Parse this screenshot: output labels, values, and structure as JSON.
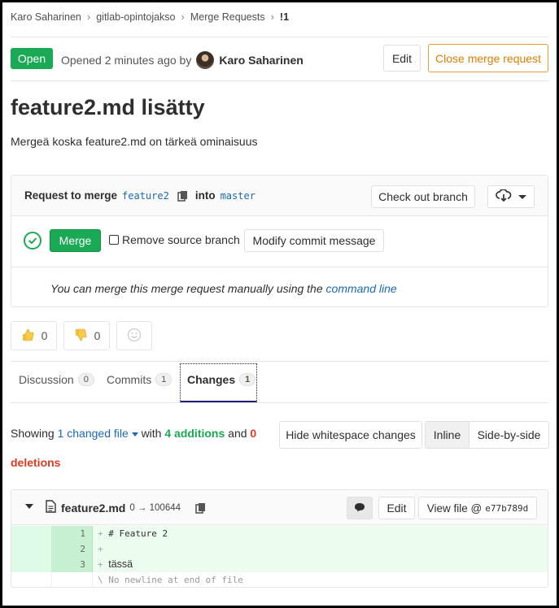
{
  "breadcrumb": [
    "Karo Saharinen",
    "gitlab-opintojakso",
    "Merge Requests",
    "!1"
  ],
  "header": {
    "status": "Open",
    "opened_text": "Opened 2 minutes ago by",
    "author": "Karo Saharinen",
    "edit_label": "Edit",
    "close_label": "Close merge request"
  },
  "mr": {
    "title": "feature2.md lisätty",
    "description": "Mergeä koska feature2.md on tärkeä ominaisuus"
  },
  "widget": {
    "request_prefix": "Request to merge",
    "source_branch": "feature2",
    "into_label": "into",
    "target_branch": "master",
    "checkout_label": "Check out branch",
    "merge_label": "Merge",
    "remove_source_label": "Remove source branch",
    "modify_commit_label": "Modify commit message",
    "manual_text": "You can merge this merge request manually using the",
    "manual_link": "command line"
  },
  "awards": {
    "thumbsup_count": "0",
    "thumbsdown_count": "0"
  },
  "tabs": [
    {
      "label": "Discussion",
      "count": "0"
    },
    {
      "label": "Commits",
      "count": "1"
    },
    {
      "label": "Changes",
      "count": "1"
    }
  ],
  "changes": {
    "showing": "Showing",
    "changed_files": "1 changed file",
    "with": "with",
    "additions": "4 additions",
    "and": "and",
    "deletions_count": "0",
    "deletions_word": "deletions",
    "hide_whitespace": "Hide whitespace changes",
    "inline": "Inline",
    "side_by_side": "Side-by-side"
  },
  "diff": {
    "file_name": "feature2.md",
    "mode": "0 → 100644",
    "edit_label": "Edit",
    "view_file_label": "View file @",
    "commit_sha": "e77b789d",
    "lines": [
      {
        "num": "1",
        "text": "# Feature 2"
      },
      {
        "num": "2",
        "text": ""
      },
      {
        "num": "3",
        "text": "tässä"
      }
    ],
    "no_newline": "\\ No newline at end of file"
  },
  "colors": {
    "open": "#1aaa55",
    "link": "#1b69b6",
    "close": "#de7e00",
    "deletions": "#db3b21"
  }
}
